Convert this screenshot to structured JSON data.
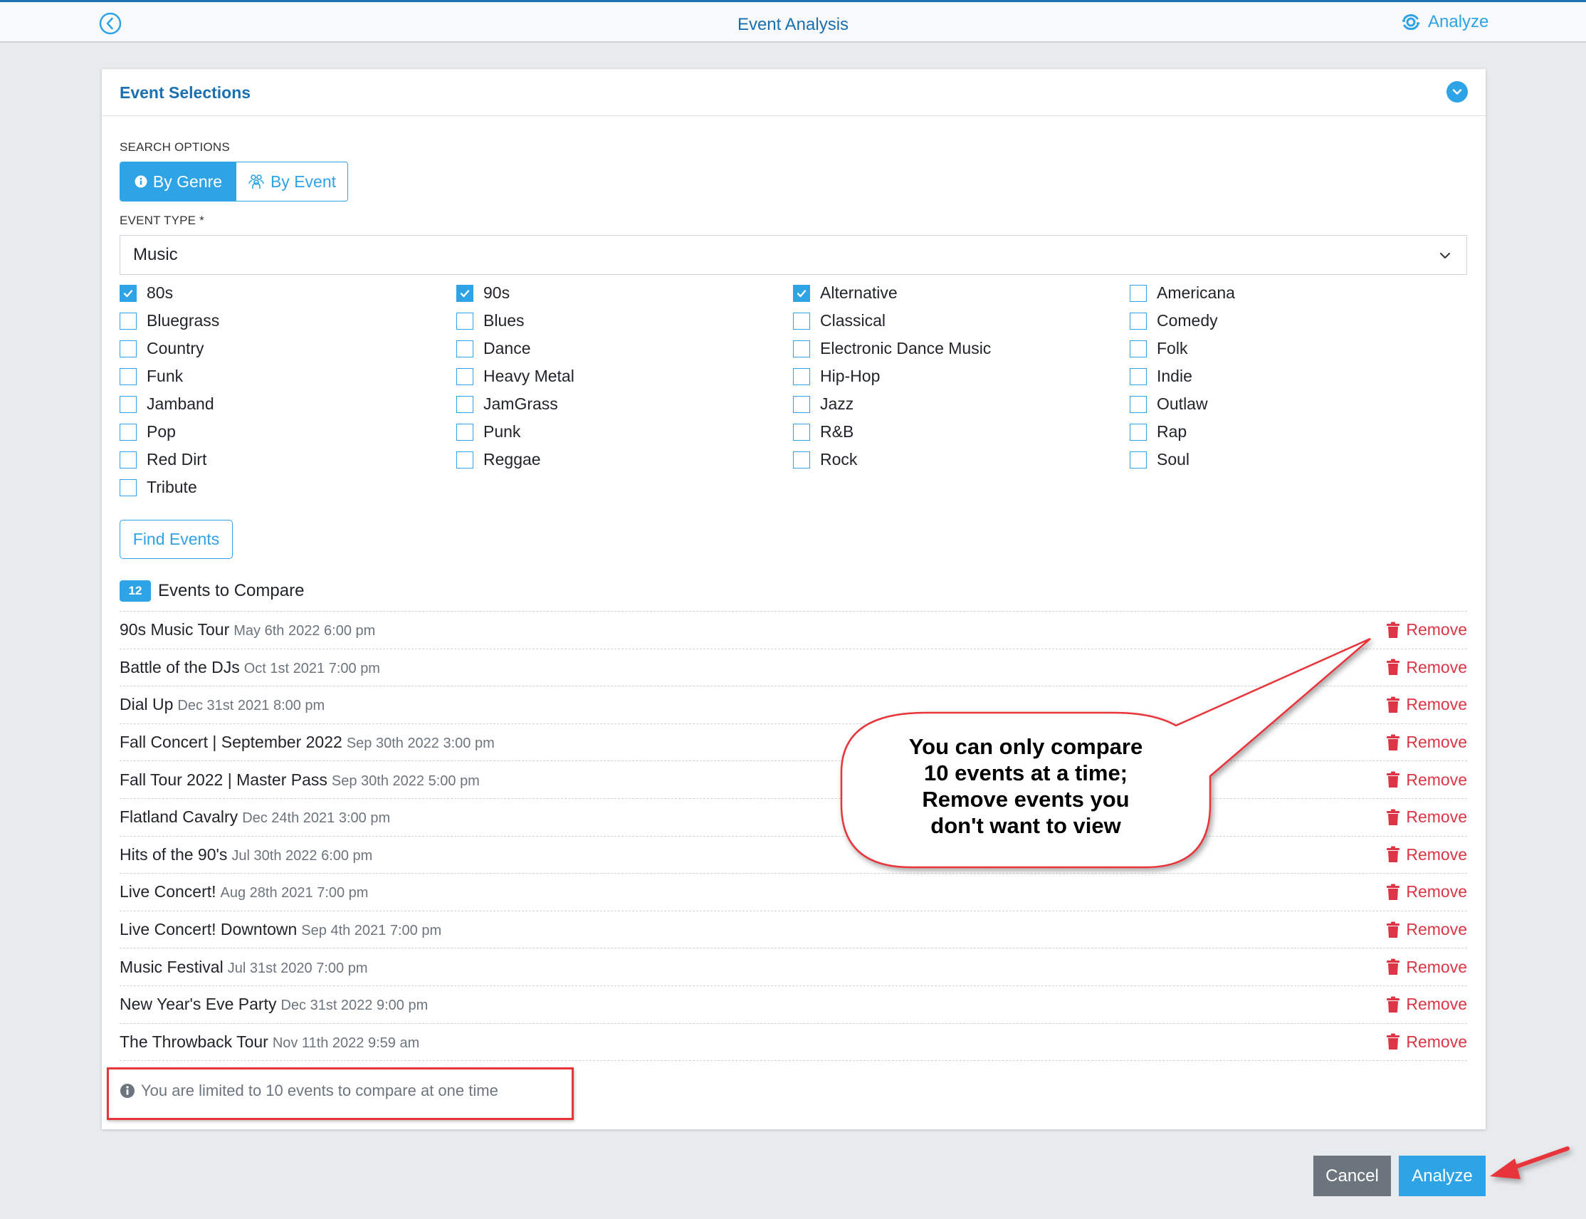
{
  "header": {
    "title": "Event Analysis",
    "analyze_label": "Analyze",
    "back_icon": "chevron-left-circle-icon",
    "analyze_icon": "analyze-eye-icon"
  },
  "card": {
    "title": "Event Selections",
    "collapse_icon": "chevron-down-circle-icon"
  },
  "search_options": {
    "label": "SEARCH OPTIONS",
    "by_genre": "By Genre",
    "by_event": "By Event",
    "active": "By Genre"
  },
  "event_type": {
    "label": "EVENT TYPE *",
    "value": "Music"
  },
  "genres": [
    {
      "label": "80s",
      "checked": true
    },
    {
      "label": "90s",
      "checked": true
    },
    {
      "label": "Alternative",
      "checked": true
    },
    {
      "label": "Americana",
      "checked": false
    },
    {
      "label": "Bluegrass",
      "checked": false
    },
    {
      "label": "Blues",
      "checked": false
    },
    {
      "label": "Classical",
      "checked": false
    },
    {
      "label": "Comedy",
      "checked": false
    },
    {
      "label": "Country",
      "checked": false
    },
    {
      "label": "Dance",
      "checked": false
    },
    {
      "label": "Electronic Dance Music",
      "checked": false
    },
    {
      "label": "Folk",
      "checked": false
    },
    {
      "label": "Funk",
      "checked": false
    },
    {
      "label": "Heavy Metal",
      "checked": false
    },
    {
      "label": "Hip-Hop",
      "checked": false
    },
    {
      "label": "Indie",
      "checked": false
    },
    {
      "label": "Jamband",
      "checked": false
    },
    {
      "label": "JamGrass",
      "checked": false
    },
    {
      "label": "Jazz",
      "checked": false
    },
    {
      "label": "Outlaw",
      "checked": false
    },
    {
      "label": "Pop",
      "checked": false
    },
    {
      "label": "Punk",
      "checked": false
    },
    {
      "label": "R&B",
      "checked": false
    },
    {
      "label": "Rap",
      "checked": false
    },
    {
      "label": "Red Dirt",
      "checked": false
    },
    {
      "label": "Reggae",
      "checked": false
    },
    {
      "label": "Rock",
      "checked": false
    },
    {
      "label": "Soul",
      "checked": false
    },
    {
      "label": "Tribute",
      "checked": false
    }
  ],
  "find_events_label": "Find Events",
  "compare": {
    "count": "12",
    "title": "Events to Compare",
    "remove_label": "Remove",
    "events": [
      {
        "name": "90s Music Tour",
        "date": "May 6th 2022 6:00 pm"
      },
      {
        "name": "Battle of the DJs",
        "date": "Oct 1st 2021 7:00 pm"
      },
      {
        "name": "Dial Up",
        "date": "Dec 31st 2021 8:00 pm"
      },
      {
        "name": "Fall Concert | September 2022",
        "date": "Sep 30th 2022 3:00 pm"
      },
      {
        "name": "Fall Tour 2022 | Master Pass",
        "date": "Sep 30th 2022 5:00 pm"
      },
      {
        "name": "Flatland Cavalry",
        "date": "Dec 24th 2021 3:00 pm"
      },
      {
        "name": "Hits of the 90's",
        "date": "Jul 30th 2022 6:00 pm"
      },
      {
        "name": "Live Concert!",
        "date": "Aug 28th 2021 7:00 pm"
      },
      {
        "name": "Live Concert! Downtown",
        "date": "Sep 4th 2021 7:00 pm"
      },
      {
        "name": "Music Festival",
        "date": "Jul 31st 2020 7:00 pm"
      },
      {
        "name": "New Year's Eve Party",
        "date": "Dec 31st 2022 9:00 pm"
      },
      {
        "name": "The Throwback Tour",
        "date": "Nov 11th 2022 9:59 am"
      }
    ],
    "limit_note": "You are limited to 10 events to compare at one time"
  },
  "annotation": {
    "callout_lines": [
      "You can only compare",
      "10 events at a time;",
      "Remove events you",
      "don't want to view"
    ]
  },
  "footer": {
    "cancel_label": "Cancel",
    "analyze_label": "Analyze"
  },
  "colors": {
    "primary": "#2ea3e6",
    "title_blue": "#1a6fb0",
    "danger": "#dc3545",
    "secondary": "#6c757d",
    "annotation_red": "#e8343a"
  }
}
